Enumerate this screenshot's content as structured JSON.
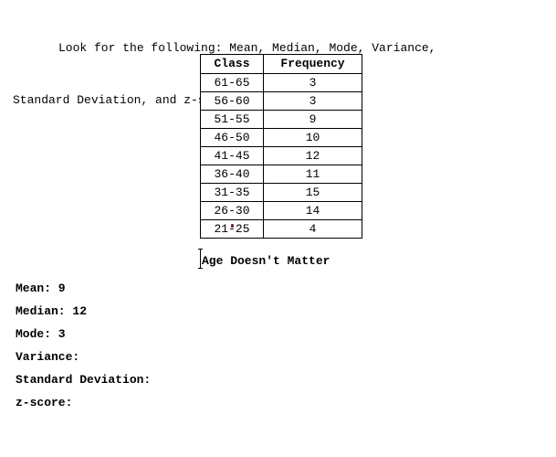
{
  "document": {
    "intro": {
      "line_1": "Look for the following: Mean, Median, Mode, Variance,",
      "line_2": "Standard Deviation, and z-score."
    },
    "table": {
      "headers": {
        "class": "Class",
        "frequency": "Frequency"
      },
      "rows": [
        {
          "class": "61-65",
          "frequency": "3"
        },
        {
          "class": "56-60",
          "frequency": "3"
        },
        {
          "class": "51-55",
          "frequency": "9"
        },
        {
          "class": "46-50",
          "frequency": "10"
        },
        {
          "class": "41-45",
          "frequency": "12"
        },
        {
          "class": "36-40",
          "frequency": "11"
        },
        {
          "class": "31-35",
          "frequency": "15"
        },
        {
          "class": "26-30",
          "frequency": "14"
        },
        {
          "class": "21-25",
          "frequency": "4"
        }
      ]
    },
    "caption": "Age Doesn't Matter",
    "stats": [
      {
        "label": "Mean:",
        "value": "9",
        "text": "Mean: 9"
      },
      {
        "label": "Median:",
        "value": "12",
        "text": "Median: 12"
      },
      {
        "label": "Mode:",
        "value": "3",
        "text": "Mode: 3"
      },
      {
        "label": "Variance:",
        "value": "",
        "text": "Variance:"
      },
      {
        "label": "Standard Deviation:",
        "value": "",
        "text": "Standard Deviation:"
      },
      {
        "label": "z-score:",
        "value": "",
        "text": "z-score:"
      }
    ],
    "colors": {
      "background": "#ffffff",
      "text": "#000000",
      "border": "#000000",
      "caret_artifact": "#8b1a2b"
    }
  },
  "chart_data": {
    "type": "table",
    "title": "Age Doesn't Matter",
    "categories": [
      "61-65",
      "56-60",
      "51-55",
      "46-50",
      "41-45",
      "36-40",
      "31-35",
      "26-30",
      "21-25"
    ],
    "values": [
      3,
      3,
      9,
      10,
      12,
      11,
      15,
      14,
      4
    ],
    "xlabel": "Class",
    "ylabel": "Frequency"
  }
}
